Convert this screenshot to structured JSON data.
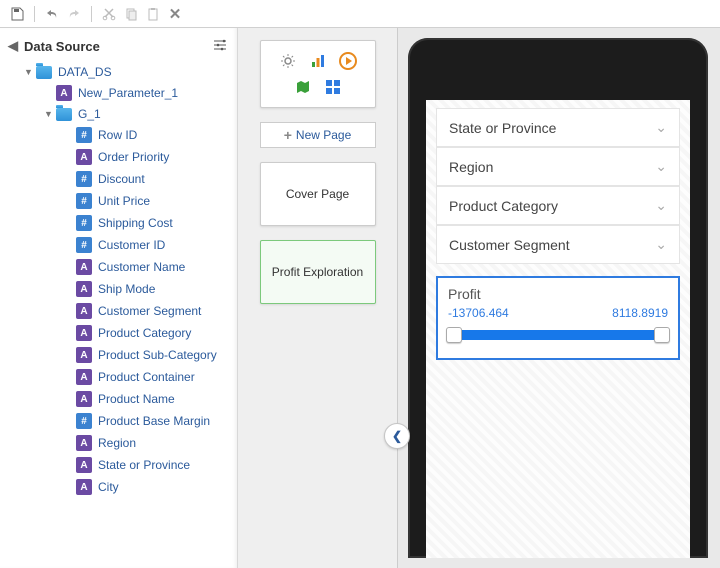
{
  "left": {
    "header": "Data Source",
    "nodes": [
      {
        "depth": 1,
        "type": "folder",
        "twisty": "▼",
        "label": "DATA_DS"
      },
      {
        "depth": 2,
        "type": "a",
        "twisty": "",
        "label": "New_Parameter_1"
      },
      {
        "depth": 2,
        "type": "folder",
        "twisty": "▼",
        "label": "G_1"
      },
      {
        "depth": 3,
        "type": "hash",
        "label": "Row ID"
      },
      {
        "depth": 3,
        "type": "a",
        "label": "Order Priority"
      },
      {
        "depth": 3,
        "type": "hash",
        "label": "Discount"
      },
      {
        "depth": 3,
        "type": "hash",
        "label": "Unit Price"
      },
      {
        "depth": 3,
        "type": "hash",
        "label": "Shipping Cost"
      },
      {
        "depth": 3,
        "type": "hash",
        "label": "Customer ID"
      },
      {
        "depth": 3,
        "type": "a",
        "label": "Customer Name"
      },
      {
        "depth": 3,
        "type": "a",
        "label": "Ship Mode"
      },
      {
        "depth": 3,
        "type": "a",
        "label": "Customer Segment"
      },
      {
        "depth": 3,
        "type": "a",
        "label": "Product Category"
      },
      {
        "depth": 3,
        "type": "a",
        "label": "Product Sub-Category"
      },
      {
        "depth": 3,
        "type": "a",
        "label": "Product Container"
      },
      {
        "depth": 3,
        "type": "a",
        "label": "Product Name"
      },
      {
        "depth": 3,
        "type": "hash",
        "label": "Product Base Margin"
      },
      {
        "depth": 3,
        "type": "a",
        "label": "Region"
      },
      {
        "depth": 3,
        "type": "a",
        "label": "State or Province"
      },
      {
        "depth": 3,
        "type": "a",
        "label": "City"
      }
    ]
  },
  "mid": {
    "new_page": "New Page",
    "pages": [
      {
        "label": "Cover Page",
        "selected": false
      },
      {
        "label": "Profit Exploration",
        "selected": true
      }
    ]
  },
  "right": {
    "filters": [
      {
        "label": "State or Province"
      },
      {
        "label": "Region"
      },
      {
        "label": "Product Category"
      },
      {
        "label": "Customer Segment"
      }
    ],
    "profit": {
      "title": "Profit",
      "min": "-13706.464",
      "max": "8118.8919"
    }
  }
}
